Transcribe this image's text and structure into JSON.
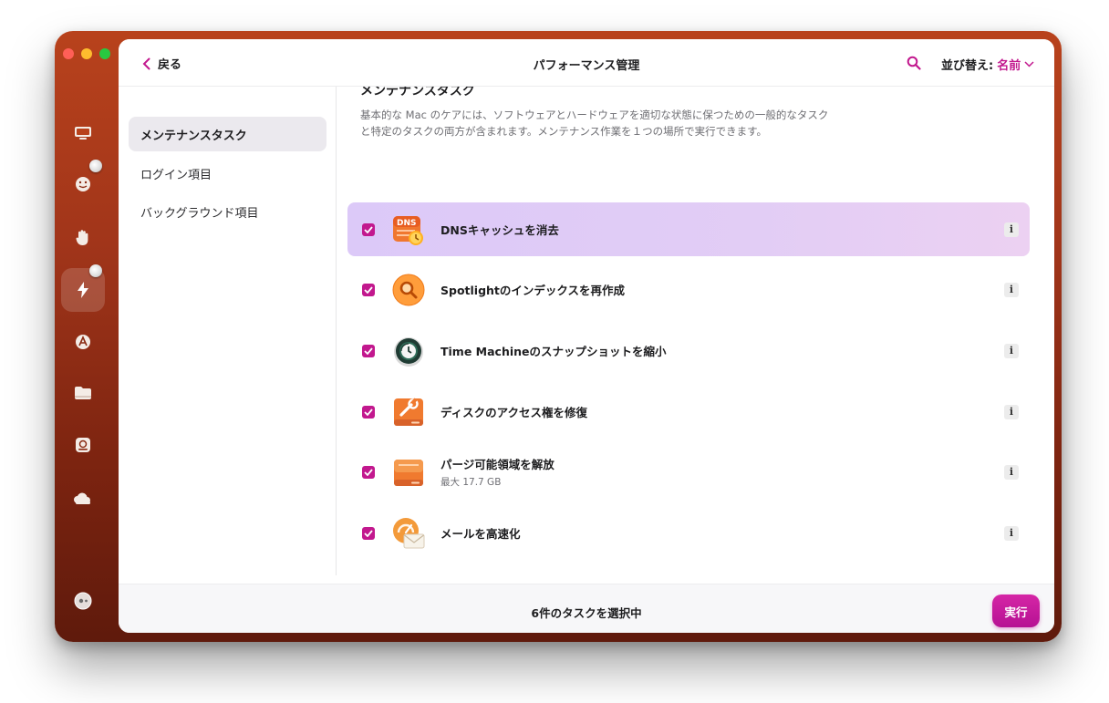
{
  "window": {
    "title": "パフォーマンス管理",
    "back_label": "戻る",
    "sort_label": "並び替え:",
    "sort_value": "名前"
  },
  "rail": {
    "items": [
      "monitor-icon",
      "smiley-icon",
      "hand-icon",
      "lightning-icon",
      "apps-icon",
      "folder-icon",
      "disk-icon",
      "cloud-icon"
    ],
    "active": "lightning-icon",
    "footer_icon": "assistant-icon"
  },
  "sidebar": {
    "items": [
      {
        "label": "メンテナンスタスク",
        "active": true
      },
      {
        "label": "ログイン項目",
        "active": false
      },
      {
        "label": "バックグラウンド項目",
        "active": false
      }
    ]
  },
  "section": {
    "title": "メンテナンスタスク",
    "description": "基本的な Mac のケアには、ソフトウェアとハードウェアを適切な状態に保つための一般的なタスクと特定のタスクの両方が含まれます。メンテナンス作業を１つの場所で実行できます。"
  },
  "tasks": [
    {
      "label": "DNSキャッシュを消去",
      "sub": "",
      "checked": true,
      "selected": true,
      "icon": "dns-icon",
      "icon_text": "DNS"
    },
    {
      "label": "Spotlightのインデックスを再作成",
      "sub": "",
      "checked": true,
      "selected": false,
      "icon": "spotlight-icon"
    },
    {
      "label": "Time Machineのスナップショットを縮小",
      "sub": "",
      "checked": true,
      "selected": false,
      "icon": "time-machine-icon"
    },
    {
      "label": "ディスクのアクセス権を修復",
      "sub": "",
      "checked": true,
      "selected": false,
      "icon": "wrench-disk-icon"
    },
    {
      "label": "パージ可能領域を解放",
      "sub": "最大 17.7 GB",
      "checked": true,
      "selected": false,
      "icon": "disk-drive-icon"
    },
    {
      "label": "メールを高速化",
      "sub": "",
      "checked": true,
      "selected": false,
      "icon": "mail-speed-icon"
    }
  ],
  "footer": {
    "status": "6件のタスクを選択中",
    "run_label": "実行"
  },
  "colors": {
    "accent": "#c2188e",
    "window_bg": "#a1351a",
    "selected_row": "#dcc9f8"
  }
}
